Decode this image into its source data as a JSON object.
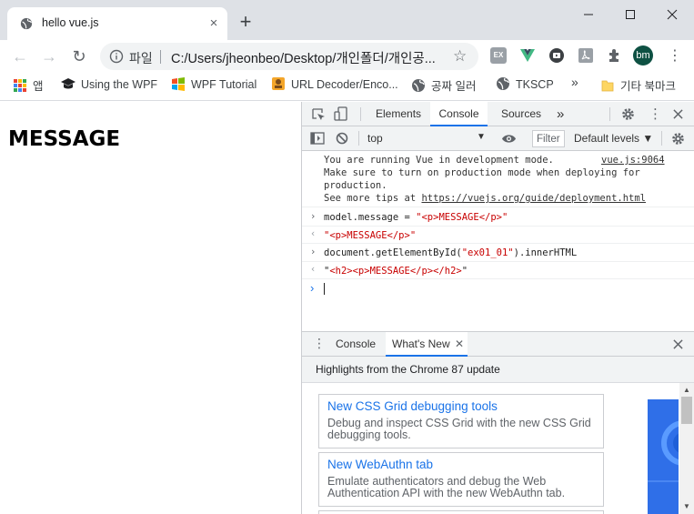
{
  "tab": {
    "title": "hello vue.js",
    "close": "×",
    "new_tab": "+"
  },
  "window": {
    "minimize": "—",
    "maximize": "☐",
    "close": "✕"
  },
  "toolbar": {
    "back": "←",
    "forward": "→",
    "reload": "↻",
    "site_label": "파일",
    "url": "C:/Users/jheonbeo/Desktop/개인폴더/개인공...",
    "avatar": "bm",
    "ext_ex": "EX"
  },
  "bookmarks": {
    "items": [
      "앱",
      "Using the WPF",
      "WPF Tutorial",
      "URL Decoder/Enco...",
      "공짜 일러",
      "TKSCP"
    ],
    "overflow": "»",
    "other": "기타 북마크"
  },
  "page": {
    "heading": "MESSAGE"
  },
  "devtools": {
    "tabs": [
      "Elements",
      "Console",
      "Sources"
    ],
    "active_tab": "Console",
    "more_tabs": "»",
    "context": "top",
    "filter_placeholder": "Filter",
    "levels": "Default levels ▼",
    "vue_msg_1": "You are running Vue in development mode.",
    "vue_source": "vue.js:9064",
    "vue_msg_2": "Make sure to turn on production mode when deploying for",
    "vue_msg_3": "production.",
    "vue_msg_4_prefix": "See more tips at ",
    "vue_msg_4_link": "https://vuejs.org/guide/deployment.html",
    "cmd1_prefix": "model.message = ",
    "cmd1_string": "\"<p>MESSAGE</p>\"",
    "res1": "\"<p>MESSAGE</p>\"",
    "cmd2_prefix": "document.getElementById(",
    "cmd2_arg": "\"ex01_01\"",
    "cmd2_suffix": ").innerHTML",
    "res2_q1": "\"",
    "res2_body": "<h2><p>MESSAGE</p></h2>",
    "res2_q2": "\"",
    "drawer_tabs": [
      "Console",
      "What's New"
    ],
    "drawer_active": "What's New",
    "drawer_header": "Highlights from the Chrome 87 update",
    "cards": [
      {
        "title": "New CSS Grid debugging tools",
        "desc": "Debug and inspect CSS Grid with the new CSS Grid debugging tools."
      },
      {
        "title": "New WebAuthn tab",
        "desc": "Emulate authenticators and debug the Web Authentication API with the new WebAuthn tab."
      }
    ]
  },
  "colors": {
    "accent": "#1a73e8",
    "string": "#c80000",
    "chrome_bg": "#dee1e6",
    "devtools_bar": "#f1f3f4"
  }
}
